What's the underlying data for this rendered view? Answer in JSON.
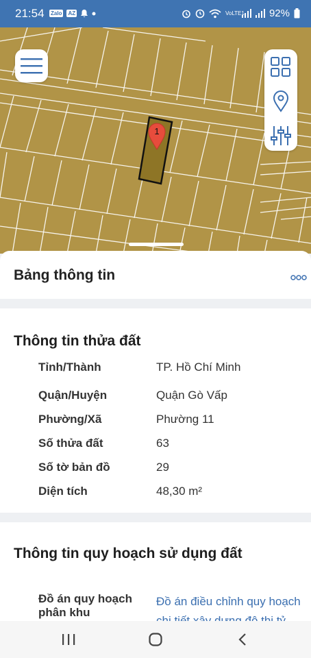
{
  "status_bar": {
    "time": "21:54",
    "notif_badges": [
      "Zalo",
      "AZ"
    ],
    "battery": "92%",
    "net_label": "VoLTE1"
  },
  "map": {
    "marker_label": "1",
    "parcel_color": "#8e7526",
    "land_color": "#b19447"
  },
  "sheet": {
    "title": "Bảng thông tin"
  },
  "parcel_info": {
    "title": "Thông tin thửa đất",
    "rows": [
      {
        "label": "Tỉnh/Thành",
        "value": "TP. Hồ Chí Minh"
      },
      {
        "label": "Quận/Huyện",
        "value": "Quận Gò Vấp"
      },
      {
        "label": "Phường/Xã",
        "value": "Phường 11"
      },
      {
        "label": "Số thửa đất",
        "value": "63"
      },
      {
        "label": "Số tờ bản đồ",
        "value": "29"
      },
      {
        "label": "Diện tích",
        "value": "48,30 m²"
      }
    ]
  },
  "planning_info": {
    "title": "Thông tin quy hoạch sử dụng đất",
    "label_line1": "Đồ án quy hoạch",
    "label_line2": "phân khu",
    "link_line1": "Đồ án điều chỉnh quy hoạch",
    "link_line2": "chi tiết xây dựng đô thị tỷ",
    "link_color": "#3b6fb0"
  }
}
